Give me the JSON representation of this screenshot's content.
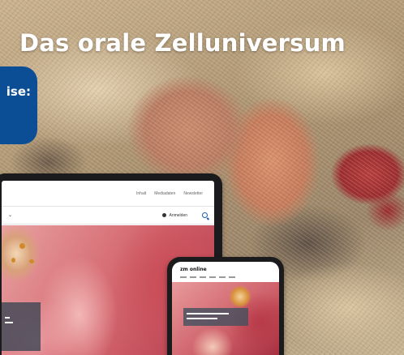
{
  "hero": {
    "title": "Das orale Zelluniversum"
  },
  "badge": {
    "label": "ise:"
  },
  "tablet": {
    "topnav": [
      "Inhalt",
      "Mediadaten",
      "Newsletter"
    ],
    "login_label": "Anmelden",
    "icons": {
      "login": "user-icon",
      "search": "search-icon",
      "menu": "chevron-down-icon"
    }
  },
  "phone": {
    "logo": "zm online"
  },
  "colors": {
    "badge_blue": "#0b4e96",
    "headline": "#ffffff",
    "device_frame": "#1b1b1d"
  }
}
